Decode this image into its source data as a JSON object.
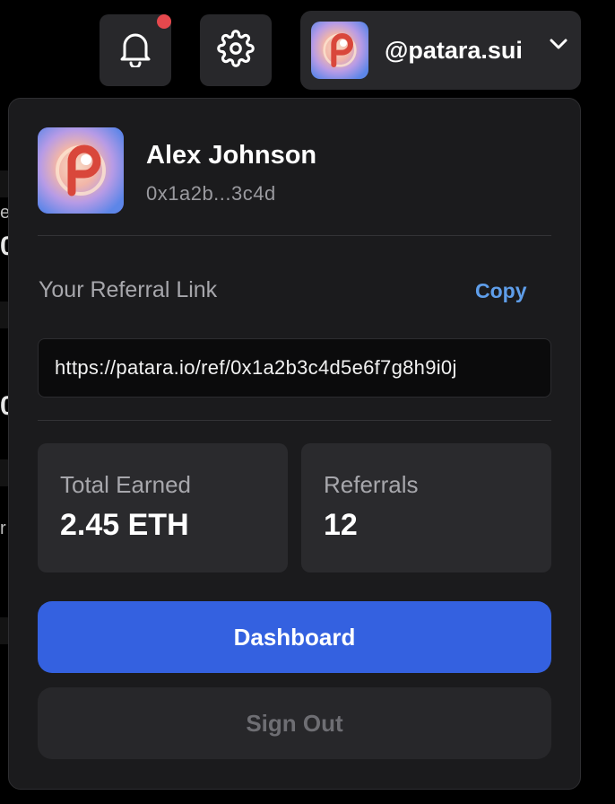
{
  "colors": {
    "background": "#000000",
    "panel": "#1b1b1d",
    "accent": "#3461e0",
    "link": "#5f9eea",
    "notification": "#e5484d"
  },
  "header": {
    "notifications_icon": "bell-icon",
    "settings_icon": "gear-icon",
    "profile_handle": "@patara.sui",
    "dropdown_icon": "chevron-down-icon"
  },
  "background_fragments": [
    "e",
    "0",
    "0",
    "r"
  ],
  "profile_menu": {
    "name": "Alex Johnson",
    "address": "0x1a2b...3c4d",
    "referral": {
      "label": "Your Referral Link",
      "copy_label": "Copy",
      "link": "https://patara.io/ref/0x1a2b3c4d5e6f7g8h9i0j"
    },
    "stats": [
      {
        "label": "Total Earned",
        "value": "2.45 ETH"
      },
      {
        "label": "Referrals",
        "value": "12"
      }
    ],
    "dashboard_label": "Dashboard",
    "sign_out_label": "Sign Out"
  }
}
